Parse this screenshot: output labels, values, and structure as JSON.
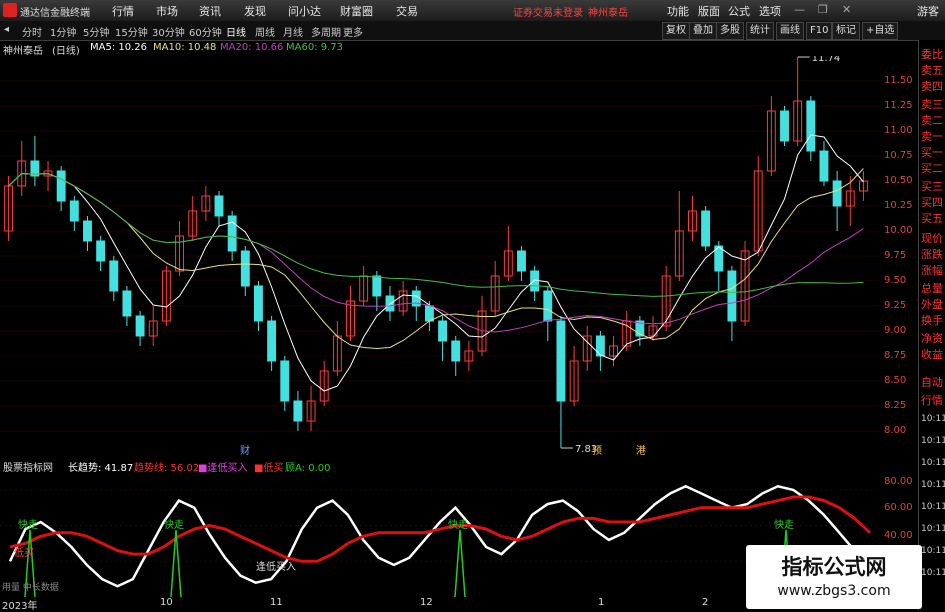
{
  "menubar": {
    "app_title": "通达信金融终端",
    "menus": [
      "行情",
      "市场",
      "资讯",
      "发现",
      "问小达",
      "财富圈",
      "交易"
    ],
    "warning": "证券交易未登录",
    "account": "神州泰岳",
    "right_menus": [
      "功能",
      "版面",
      "公式",
      "选项"
    ],
    "guest": "游客"
  },
  "periods": [
    "分时",
    "1分钟",
    "5分钟",
    "15分钟",
    "30分钟",
    "60分钟",
    "日线",
    "周线",
    "月线",
    "多周期",
    "更多"
  ],
  "active_period": "日线",
  "toolbar": [
    "复权",
    "叠加",
    "多股",
    "统计",
    "画线",
    "F10",
    "标记",
    "+自选"
  ],
  "info": {
    "stock": "神州泰岳",
    "period": "(日线)",
    "ma5": "MA5: 10.26",
    "ma10": "MA10: 10.48",
    "ma20": "MA20: 10.66",
    "ma60": "MA60: 9.73"
  },
  "price_labels": [
    "11.50",
    "11.25",
    "11.00",
    "10.75",
    "10.50",
    "10.25",
    "10.00",
    "9.75",
    "9.50",
    "9.25",
    "9.00",
    "8.75",
    "8.50",
    "8.25",
    "8.00"
  ],
  "annotations": {
    "high": "11.74",
    "low": "7.83",
    "cai": "财",
    "yu": "预",
    "gang": "港"
  },
  "indicator": {
    "name": "股票指标网",
    "long_trend": "长趋势: 41.87",
    "short_trend": "趋势线: 56.02",
    "bottom_buy": "■逢低买入",
    "low_buy": "■低买",
    "feia": "顾A: 0.00",
    "labels": [
      "80.00",
      "60.00",
      "40.00"
    ],
    "kuaizou": "快走",
    "dibuy": "低买",
    "fengdi_label": "逢低买入",
    "usage": "用量 中长数据"
  },
  "dates": [
    "2023年",
    "10",
    "11",
    "12",
    "1",
    "2"
  ],
  "side_items": [
    "委比",
    "卖五",
    "卖四",
    "卖三",
    "卖二",
    "卖一",
    "买一",
    "买二",
    "买三",
    "买四",
    "买五",
    "现价",
    "涨跌",
    "涨幅",
    "总量",
    "外盘",
    "换手",
    "净资",
    "收益",
    "自动",
    "行情"
  ],
  "side_times": [
    "10:11",
    "10:11",
    "10:11",
    "10:11",
    "10:11",
    "10:11",
    "10:11",
    "10:11"
  ],
  "watermark": {
    "title": "指标公式网",
    "url": "www.zbgs3.com"
  },
  "colors": {
    "up": "#ff3b3b",
    "down": "#44e0e0",
    "ma5": "#ffffff",
    "ma10": "#e8e080",
    "ma20": "#c040c0",
    "ma60": "#40c040",
    "trend": "#dd1010",
    "long": "#ffffff",
    "signal": "#20d020"
  },
  "chart_data": [
    {
      "type": "candlestick",
      "title": "神州泰岳 (日线)",
      "ylim": [
        7.75,
        11.75
      ],
      "ticks": [
        8.0,
        8.25,
        8.5,
        8.75,
        9.0,
        9.25,
        9.5,
        9.75,
        10.0,
        10.25,
        10.5,
        10.75,
        11.0,
        11.25,
        11.5
      ],
      "candles": [
        [
          10.0,
          10.45,
          10.55,
          9.9
        ],
        [
          10.45,
          10.7,
          10.9,
          10.35
        ],
        [
          10.7,
          10.55,
          10.95,
          10.45
        ],
        [
          10.55,
          10.6,
          10.7,
          10.4
        ],
        [
          10.6,
          10.3,
          10.65,
          10.2
        ],
        [
          10.3,
          10.1,
          10.35,
          10.0
        ],
        [
          10.1,
          9.9,
          10.15,
          9.8
        ],
        [
          9.9,
          9.7,
          9.95,
          9.6
        ],
        [
          9.7,
          9.4,
          9.75,
          9.3
        ],
        [
          9.4,
          9.15,
          9.45,
          9.05
        ],
        [
          9.15,
          8.95,
          9.2,
          8.85
        ],
        [
          8.95,
          9.1,
          9.25,
          8.85
        ],
        [
          9.1,
          9.6,
          9.65,
          9.05
        ],
        [
          9.6,
          9.95,
          10.1,
          9.55
        ],
        [
          9.95,
          10.2,
          10.35,
          9.9
        ],
        [
          10.2,
          10.35,
          10.45,
          10.1
        ],
        [
          10.35,
          10.15,
          10.4,
          10.05
        ],
        [
          10.15,
          9.8,
          10.2,
          9.7
        ],
        [
          9.8,
          9.45,
          9.85,
          9.35
        ],
        [
          9.45,
          9.1,
          9.5,
          9.0
        ],
        [
          9.1,
          8.7,
          9.15,
          8.6
        ],
        [
          8.7,
          8.3,
          8.75,
          8.2
        ],
        [
          8.3,
          8.1,
          8.4,
          8.0
        ],
        [
          8.1,
          8.3,
          8.45,
          8.0
        ],
        [
          8.3,
          8.6,
          8.7,
          8.25
        ],
        [
          8.6,
          8.95,
          9.1,
          8.55
        ],
        [
          8.95,
          9.3,
          9.45,
          8.9
        ],
        [
          9.3,
          9.55,
          9.65,
          9.25
        ],
        [
          9.55,
          9.35,
          9.6,
          9.2
        ],
        [
          9.35,
          9.2,
          9.45,
          9.1
        ],
        [
          9.2,
          9.4,
          9.5,
          9.15
        ],
        [
          9.4,
          9.25,
          9.45,
          9.1
        ],
        [
          9.25,
          9.1,
          9.3,
          9.0
        ],
        [
          9.1,
          8.9,
          9.15,
          8.7
        ],
        [
          8.9,
          8.7,
          8.95,
          8.55
        ],
        [
          8.7,
          8.8,
          8.9,
          8.6
        ],
        [
          8.8,
          9.2,
          9.35,
          8.75
        ],
        [
          9.2,
          9.55,
          9.7,
          9.15
        ],
        [
          9.55,
          9.8,
          10.05,
          9.5
        ],
        [
          9.8,
          9.6,
          9.85,
          9.5
        ],
        [
          9.6,
          9.4,
          9.65,
          9.3
        ],
        [
          9.4,
          9.1,
          9.45,
          8.9
        ],
        [
          9.1,
          8.3,
          9.15,
          7.83
        ],
        [
          8.3,
          8.7,
          8.85,
          8.25
        ],
        [
          8.7,
          8.95,
          9.05,
          8.6
        ],
        [
          8.95,
          8.75,
          9.0,
          8.6
        ],
        [
          8.75,
          8.85,
          8.95,
          8.65
        ],
        [
          8.85,
          9.1,
          9.2,
          8.8
        ],
        [
          9.1,
          8.95,
          9.15,
          8.85
        ],
        [
          8.95,
          9.05,
          9.15,
          8.9
        ],
        [
          9.05,
          9.55,
          9.65,
          9.0
        ],
        [
          9.55,
          10.0,
          10.4,
          9.5
        ],
        [
          10.0,
          10.2,
          10.35,
          9.9
        ],
        [
          10.2,
          9.85,
          10.25,
          9.8
        ],
        [
          9.85,
          9.6,
          9.9,
          9.4
        ],
        [
          9.6,
          9.1,
          9.65,
          8.9
        ],
        [
          9.1,
          9.8,
          9.9,
          9.05
        ],
        [
          9.8,
          10.6,
          10.75,
          9.75
        ],
        [
          10.6,
          11.2,
          11.35,
          10.55
        ],
        [
          11.2,
          10.9,
          11.25,
          10.85
        ],
        [
          10.9,
          11.3,
          11.74,
          10.85
        ],
        [
          11.3,
          10.8,
          11.35,
          10.7
        ],
        [
          10.8,
          10.5,
          10.9,
          10.45
        ],
        [
          10.5,
          10.25,
          10.6,
          10.0
        ],
        [
          10.25,
          10.4,
          10.55,
          10.05
        ],
        [
          10.4,
          10.5,
          10.6,
          10.3
        ]
      ]
    },
    {
      "type": "line",
      "title": "股票指标网",
      "ylim": [
        20,
        90
      ],
      "series": [
        {
          "name": "长趋势",
          "values": [
            40,
            58,
            62,
            56,
            48,
            38,
            30,
            26,
            30,
            46,
            62,
            74,
            70,
            55,
            42,
            32,
            28,
            30,
            40,
            58,
            70,
            74,
            66,
            52,
            42,
            38,
            42,
            52,
            62,
            70,
            60,
            48,
            44,
            52,
            66,
            72,
            74,
            68,
            58,
            52,
            56,
            64,
            72,
            78,
            82,
            78,
            74,
            70,
            72,
            78,
            82,
            80,
            74,
            66,
            56,
            46,
            42
          ]
        },
        {
          "name": "趋势线",
          "values": [
            48,
            50,
            54,
            56,
            56,
            54,
            50,
            46,
            44,
            44,
            48,
            54,
            58,
            60,
            58,
            54,
            50,
            46,
            42,
            40,
            40,
            44,
            50,
            54,
            56,
            56,
            56,
            56,
            58,
            60,
            60,
            58,
            54,
            52,
            54,
            58,
            62,
            64,
            64,
            62,
            62,
            62,
            64,
            66,
            68,
            70,
            70,
            70,
            70,
            72,
            74,
            76,
            76,
            74,
            70,
            64,
            56
          ]
        }
      ]
    }
  ]
}
